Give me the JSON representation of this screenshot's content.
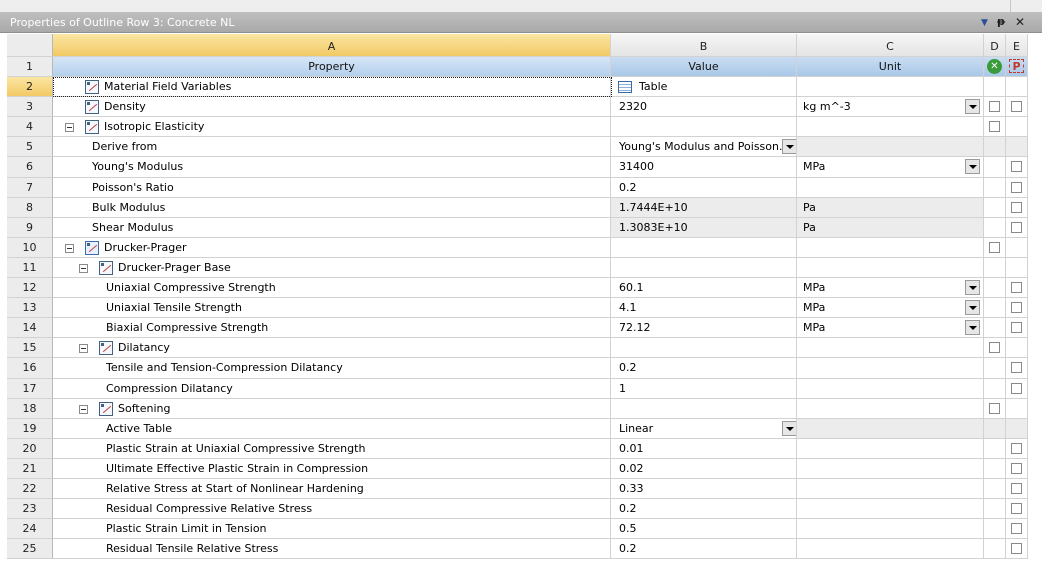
{
  "window": {
    "title": "Properties of Outline Row 3: Concrete NL",
    "controls": {
      "dropdown_icon": "dropdown-arrow-icon",
      "pin_icon": "pin-icon",
      "close_icon": "close-icon"
    }
  },
  "columns": {
    "A": "A",
    "B": "B",
    "C": "C",
    "D": "D",
    "E": "E"
  },
  "header_row": {
    "number": "1",
    "property": "Property",
    "value": "Value",
    "unit": "Unit",
    "d_icon": "check-circle-icon",
    "e_icon": "parameter-icon"
  },
  "rows": [
    {
      "n": "2",
      "label": "Material Field Variables",
      "value": "Table",
      "unit": ""
    },
    {
      "n": "3",
      "label": "Density",
      "value": "2320",
      "unit": "kg m^-3"
    },
    {
      "n": "4",
      "label": "Isotropic Elasticity",
      "value": "",
      "unit": ""
    },
    {
      "n": "5",
      "label": "Derive from",
      "value": "Young's Modulus and Poisson...",
      "unit": ""
    },
    {
      "n": "6",
      "label": "Young's Modulus",
      "value": "31400",
      "unit": "MPa"
    },
    {
      "n": "7",
      "label": "Poisson's Ratio",
      "value": "0.2",
      "unit": ""
    },
    {
      "n": "8",
      "label": "Bulk Modulus",
      "value": "1.7444E+10",
      "unit": "Pa"
    },
    {
      "n": "9",
      "label": "Shear Modulus",
      "value": "1.3083E+10",
      "unit": "Pa"
    },
    {
      "n": "10",
      "label": "Drucker-Prager",
      "value": "",
      "unit": ""
    },
    {
      "n": "11",
      "label": "Drucker-Prager Base",
      "value": "",
      "unit": ""
    },
    {
      "n": "12",
      "label": "Uniaxial Compressive Strength",
      "value": "60.1",
      "unit": "MPa"
    },
    {
      "n": "13",
      "label": "Uniaxial Tensile Strength",
      "value": "4.1",
      "unit": "MPa"
    },
    {
      "n": "14",
      "label": "Biaxial Compressive Strength",
      "value": "72.12",
      "unit": "MPa"
    },
    {
      "n": "15",
      "label": "Dilatancy",
      "value": "",
      "unit": ""
    },
    {
      "n": "16",
      "label": "Tensile and Tension-Compression Dilatancy",
      "value": "0.2",
      "unit": ""
    },
    {
      "n": "17",
      "label": "Compression Dilatancy",
      "value": "1",
      "unit": ""
    },
    {
      "n": "18",
      "label": "Softening",
      "value": "",
      "unit": ""
    },
    {
      "n": "19",
      "label": "Active Table",
      "value": "Linear",
      "unit": ""
    },
    {
      "n": "20",
      "label": "Plastic Strain at Uniaxial Compressive Strength",
      "value": "0.01",
      "unit": ""
    },
    {
      "n": "21",
      "label": "Ultimate Effective Plastic Strain in Compression",
      "value": "0.02",
      "unit": ""
    },
    {
      "n": "22",
      "label": "Relative Stress at Start of Nonlinear Hardening",
      "value": "0.33",
      "unit": ""
    },
    {
      "n": "23",
      "label": "Residual Compressive Relative Stress",
      "value": "0.2",
      "unit": ""
    },
    {
      "n": "24",
      "label": "Plastic Strain Limit in Tension",
      "value": "0.5",
      "unit": ""
    },
    {
      "n": "25",
      "label": "Residual Tensile Relative Stress",
      "value": "0.2",
      "unit": ""
    }
  ]
}
